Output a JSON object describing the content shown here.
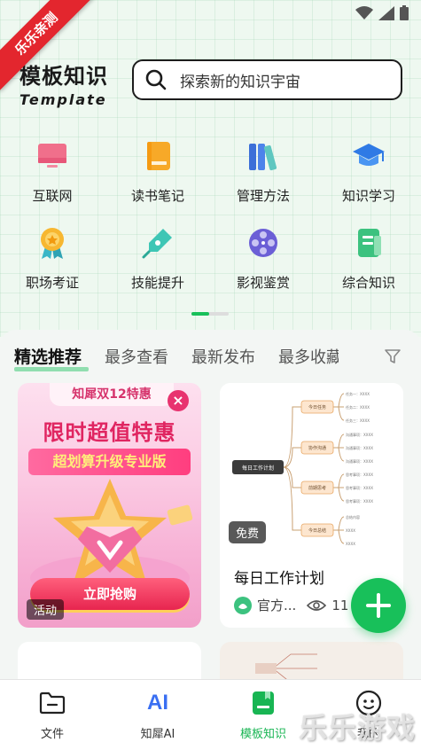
{
  "ribbon": {
    "text": "乐乐亲测"
  },
  "brand": {
    "title": "模板知识",
    "subtitle": "Template"
  },
  "search": {
    "placeholder": "探索新的知识宇宙"
  },
  "categories": [
    {
      "label": "互联网",
      "icon": "monitor-icon"
    },
    {
      "label": "读书笔记",
      "icon": "book-icon"
    },
    {
      "label": "管理方法",
      "icon": "binders-icon"
    },
    {
      "label": "知识学习",
      "icon": "graduation-cap-icon"
    },
    {
      "label": "职场考证",
      "icon": "medal-icon"
    },
    {
      "label": "技能提升",
      "icon": "pen-nib-icon"
    },
    {
      "label": "影视鉴赏",
      "icon": "film-reel-icon"
    },
    {
      "label": "综合知识",
      "icon": "document-icon"
    }
  ],
  "tabs": [
    "精选推荐",
    "最多查看",
    "最新发布",
    "最多收藏"
  ],
  "promo": {
    "badge": "知犀双12特惠",
    "title": "限时超值特惠",
    "subtitle": "超划算升级专业版",
    "button": "立即抢购",
    "tag": "活动"
  },
  "plan_card": {
    "tag": "免费",
    "title": "每日工作计划",
    "author": "官方...",
    "views": "11",
    "mindmap": {
      "root": "每日工作计划",
      "branches": [
        "今日任务",
        "协作沟通",
        "前期思考",
        "今日总结"
      ],
      "leaves": [
        [
          "任务一：XXXX",
          "任务二：XXXX",
          "任务三：XXXX"
        ],
        [
          "沟通事项：XXXX",
          "沟通事项：XXXX",
          "沟通事项：XXXX"
        ],
        [
          "思考事项：XXXX",
          "思考事项：XXXX",
          "思考事项：XXXX"
        ],
        [
          "总结内容",
          "XXXX",
          "XXXX"
        ]
      ]
    }
  },
  "bottom_nav": [
    {
      "label": "文件",
      "icon": "folder-icon"
    },
    {
      "label": "知犀AI",
      "icon": "ai-icon",
      "icon_text": "AI"
    },
    {
      "label": "模板知识",
      "icon": "template-book-icon"
    },
    {
      "label": "我的",
      "icon": "smile-face-icon"
    }
  ],
  "watermark": "乐乐游戏",
  "colors": {
    "accent": "#18c05a",
    "promo_pink": "#e02561"
  }
}
